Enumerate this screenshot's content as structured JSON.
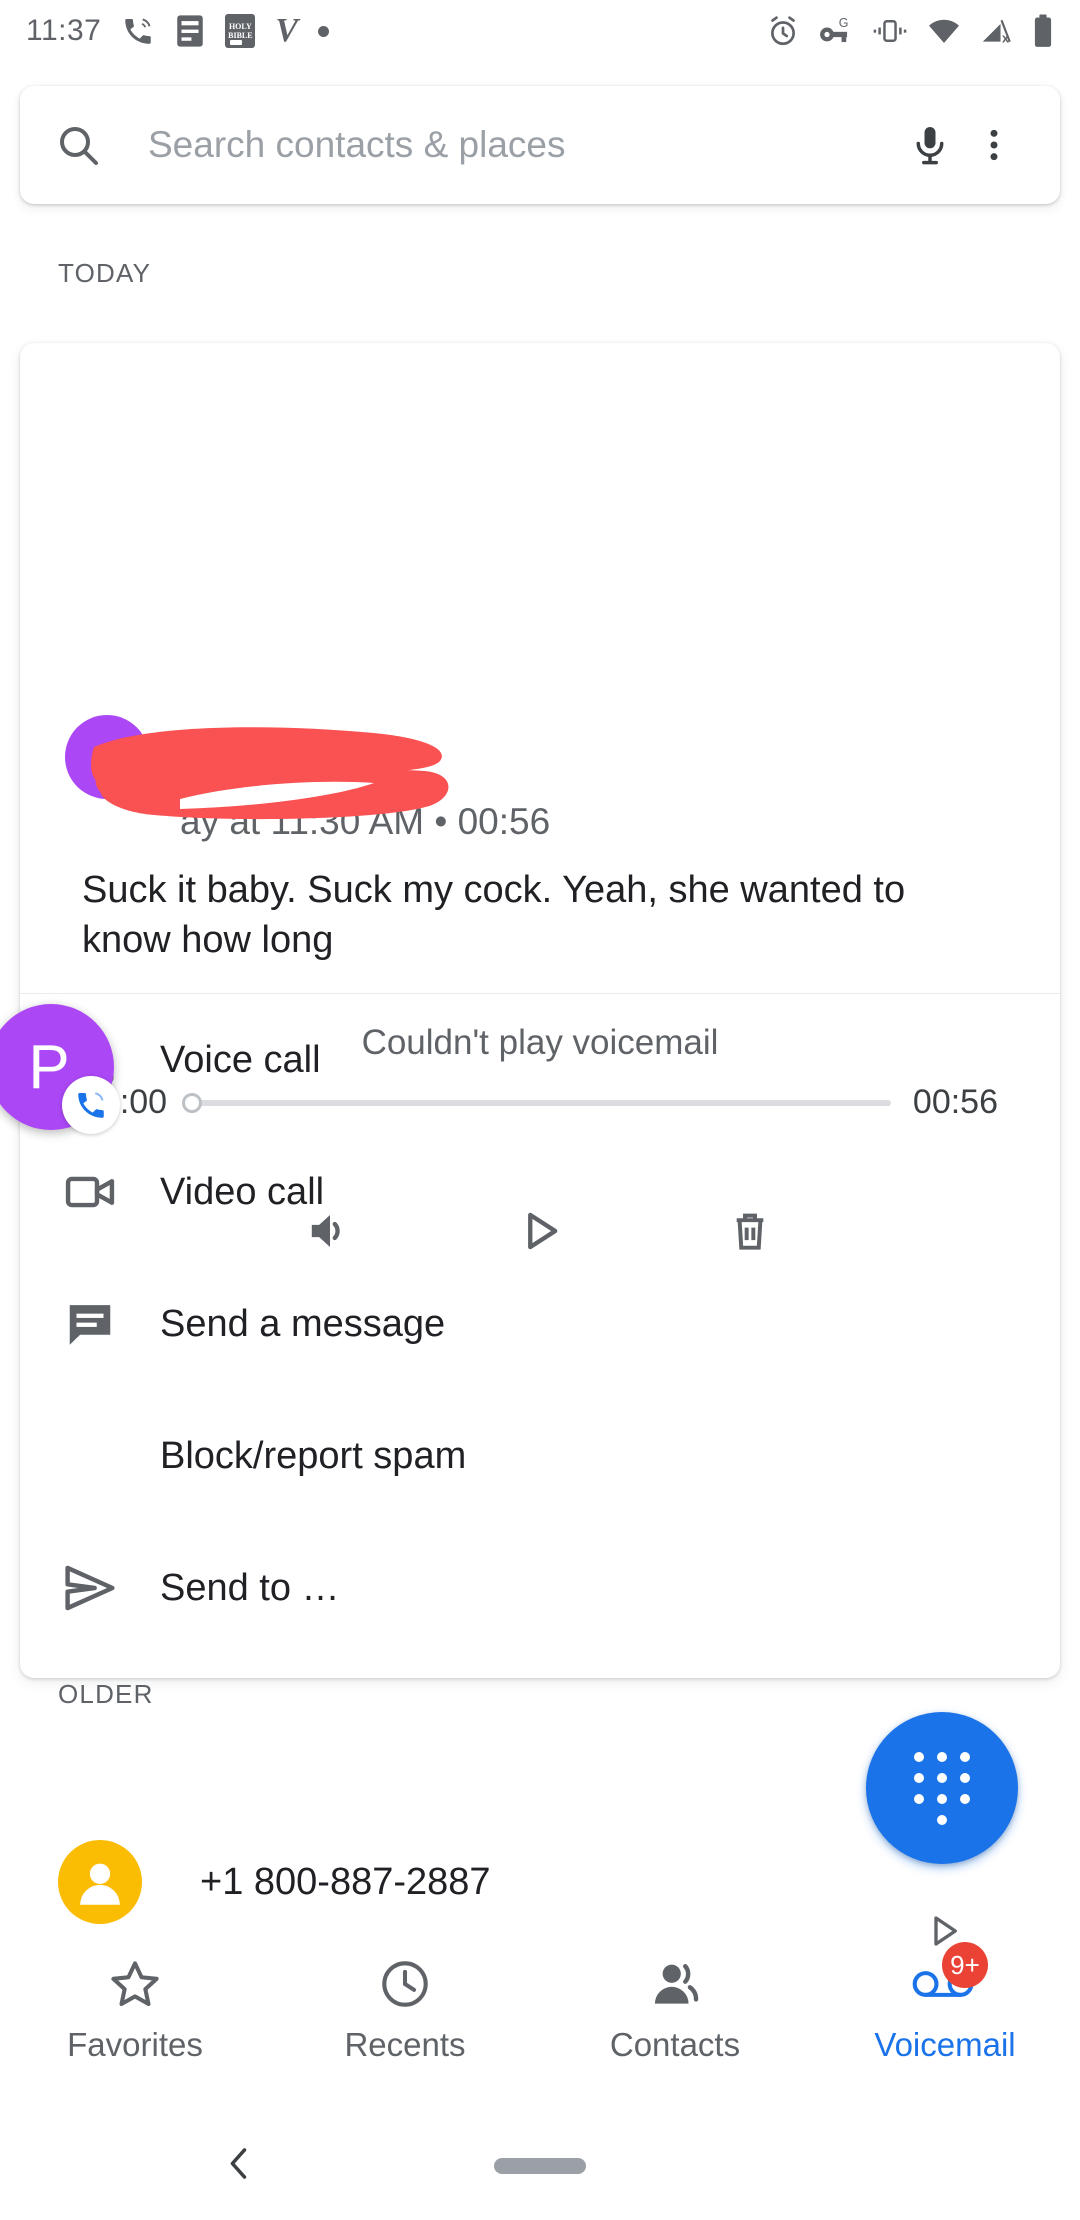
{
  "status_bar": {
    "clock": "11:37",
    "left_icons": [
      "missed-call-icon",
      "notes-icon",
      "bible-app-icon",
      "venmo-icon",
      "dot-icon"
    ],
    "bible_line1": "HOLY",
    "bible_line2": "BIBLE",
    "venmo_glyph": "V",
    "right_icons": [
      "alarm-icon",
      "vpn-key-icon",
      "vibrate-icon",
      "wifi-icon",
      "no-signal-icon",
      "battery-icon"
    ]
  },
  "search": {
    "placeholder": "Search contacts & places",
    "mic_icon": "microphone-icon",
    "overflow_icon": "more-vert-icon",
    "search_icon": "search-icon"
  },
  "sections": {
    "today": "TODAY",
    "older": "OLDER"
  },
  "voicemail": {
    "contact_name_redacted": true,
    "header_line": "ay at 11:30 AM • 00:56",
    "transcript": "Suck it baby. Suck my cock. Yeah, she wanted to know how long",
    "status": "Couldn't play voicemail",
    "time_current": "00:00",
    "time_total": "00:56",
    "progress_percent": 0,
    "controls": [
      {
        "name": "speaker-icon",
        "label": "Speaker"
      },
      {
        "name": "play-icon",
        "label": "Play"
      },
      {
        "name": "delete-icon",
        "label": "Delete"
      }
    ],
    "actions": [
      {
        "icon": "phone-icon",
        "label": "Voice call"
      },
      {
        "icon": "video-camera-icon",
        "label": "Video call"
      },
      {
        "icon": "message-icon",
        "label": "Send a message"
      },
      {
        "icon": "block-icon",
        "label": "Block/report spam"
      },
      {
        "icon": "send-icon",
        "label": "Send to …"
      }
    ]
  },
  "call_bubble": {
    "initial": "P",
    "badge_icon": "active-call-icon",
    "avatar_color": "#ab47f5"
  },
  "older_entry": {
    "number": "+1 800-887-2887",
    "avatar_color": "#fbbc04",
    "avatar_icon": "person-icon"
  },
  "fab": {
    "icon": "dialpad-icon",
    "color": "#1a73e8"
  },
  "bottom_nav": {
    "items": [
      {
        "icon": "star-icon",
        "label": "Favorites",
        "active": false,
        "badge": null
      },
      {
        "icon": "clock-icon",
        "label": "Recents",
        "active": false,
        "badge": null
      },
      {
        "icon": "contacts-icon",
        "label": "Contacts",
        "active": false,
        "badge": null
      },
      {
        "icon": "voicemail-icon",
        "label": "Voicemail",
        "active": true,
        "badge": "9+"
      }
    ],
    "active_color": "#1a73e8",
    "badge_color": "#ea4335"
  },
  "system_nav": {
    "back_icon": "back-chevron-icon",
    "home_pill": "home-pill"
  }
}
